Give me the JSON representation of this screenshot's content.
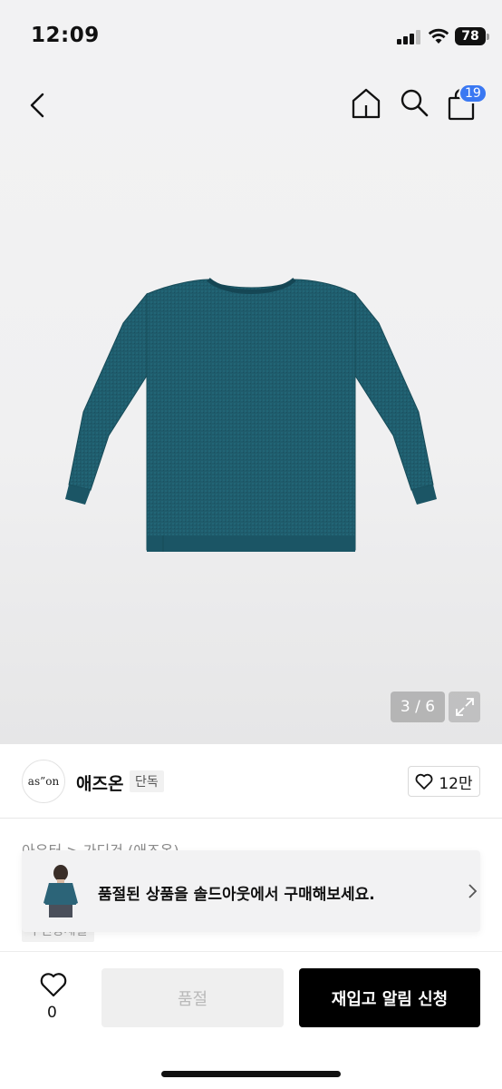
{
  "status_bar": {
    "time": "12:09",
    "battery": "78"
  },
  "header": {
    "cart_count": "19"
  },
  "gallery": {
    "page_indicator": "3 / 6"
  },
  "brand": {
    "logo_text": "as”on",
    "name": "애즈온",
    "badge": "단독",
    "likes": "12만"
  },
  "product": {
    "category_partial": "아우터 > 가디건 (애즈온)",
    "tag_partial": "무진장세일"
  },
  "soldout_banner": {
    "text": "품절된 상품을 솔드아웃에서 구매해보세요."
  },
  "bottom_bar": {
    "wish_count": "0",
    "soldout_label": "품절",
    "restock_label": "재입고 알림 신청"
  },
  "colors": {
    "accent_badge": "#3a78f2",
    "sweater": "#1f5c6c"
  },
  "icons": [
    "chevron-left-icon",
    "home-icon",
    "search-icon",
    "shopping-bag-icon",
    "expand-icon",
    "heart-icon",
    "chevron-right-icon"
  ]
}
